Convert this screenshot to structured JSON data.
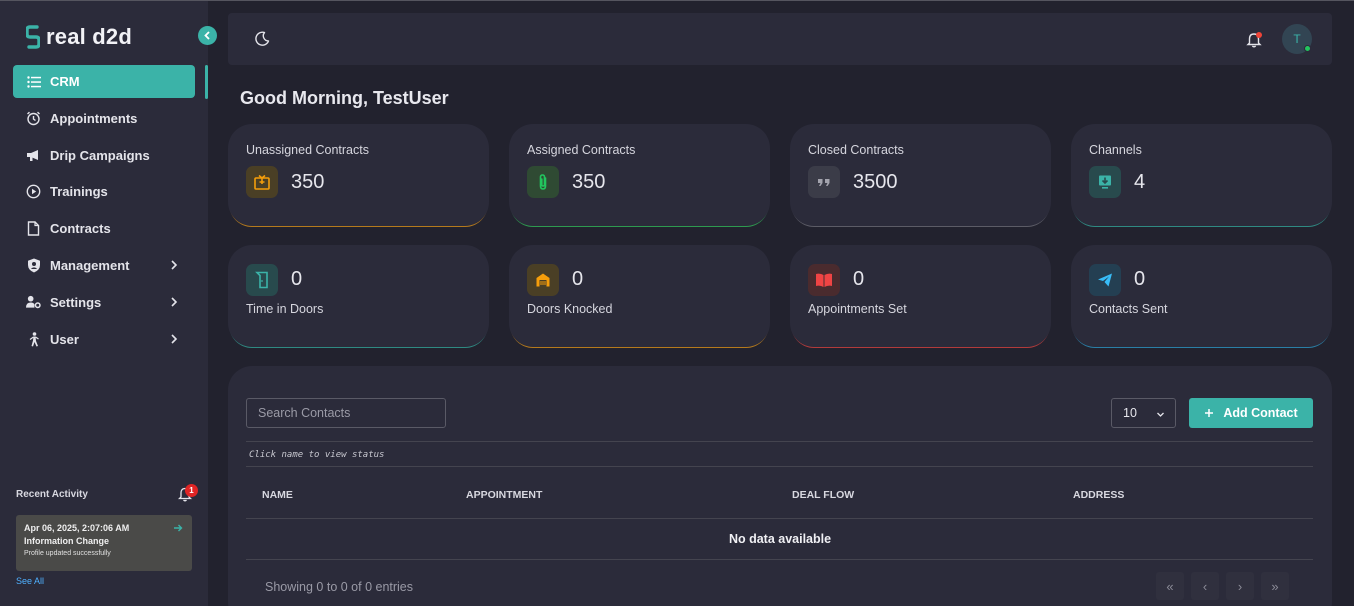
{
  "brand": {
    "name": "real d2d",
    "accent": "#3bb3a8"
  },
  "sidebar": {
    "items": [
      {
        "label": "CRM",
        "icon": "list-icon",
        "active": true
      },
      {
        "label": "Appointments",
        "icon": "alarm-clock-icon"
      },
      {
        "label": "Drip Campaigns",
        "icon": "megaphone-icon"
      },
      {
        "label": "Trainings",
        "icon": "play-circle-icon"
      },
      {
        "label": "Contracts",
        "icon": "file-icon"
      },
      {
        "label": "Management",
        "icon": "shield-user-icon",
        "expandable": true
      },
      {
        "label": "Settings",
        "icon": "user-gear-icon",
        "expandable": true
      },
      {
        "label": "User",
        "icon": "person-walking-icon",
        "expandable": true
      }
    ],
    "recent_activity": {
      "title": "Recent Activity",
      "badge": "1",
      "entry": {
        "date": "Apr 06, 2025, 2:07:06 AM",
        "title": "Information Change",
        "subtitle": "Profile updated successfully"
      },
      "see_all": "See All"
    }
  },
  "header": {
    "avatar_initial": "T"
  },
  "greeting": "Good Morning, TestUser",
  "stats_row1": [
    {
      "label": "Unassigned Contracts",
      "value": "350",
      "icon": "package-icon",
      "color": "#f59e0b"
    },
    {
      "label": "Assigned Contracts",
      "value": "350",
      "icon": "paperclip-icon",
      "color": "#22c55e"
    },
    {
      "label": "Closed Contracts",
      "value": "3500",
      "icon": "quote-icon",
      "color": "#9ca3af"
    },
    {
      "label": "Channels",
      "value": "4",
      "icon": "download-box-icon",
      "color": "#3bb3a8"
    }
  ],
  "stats_row2": [
    {
      "label": "Time in Doors",
      "value": "0",
      "icon": "door-icon",
      "color": "#3bb3a8"
    },
    {
      "label": "Doors Knocked",
      "value": "0",
      "icon": "garage-icon",
      "color": "#f59e0b"
    },
    {
      "label": "Appointments Set",
      "value": "0",
      "icon": "book-icon",
      "color": "#ef4444"
    },
    {
      "label": "Contacts Sent",
      "value": "0",
      "icon": "send-icon",
      "color": "#38bdf8"
    }
  ],
  "table": {
    "search_placeholder": "Search Contacts",
    "page_size": "10",
    "add_label": "Add Contact",
    "hint": "Click name to view status",
    "columns": [
      "NAME",
      "APPOINTMENT",
      "DEAL FLOW",
      "ADDRESS"
    ],
    "empty": "No data available",
    "showing": "Showing 0 to 0 of 0 entries",
    "pager": [
      "«",
      "‹",
      "›",
      "»"
    ]
  }
}
